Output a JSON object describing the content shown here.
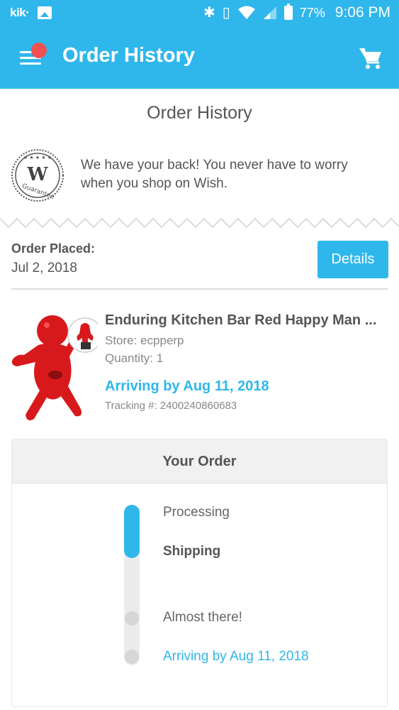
{
  "status_bar": {
    "app_label": "kik·",
    "battery_percent": "77%",
    "time": "9:06 PM",
    "icons": [
      "image-icon",
      "bluetooth-icon",
      "vibrate-icon",
      "wifi-icon",
      "signal-icon",
      "battery-icon"
    ]
  },
  "app_bar": {
    "title": "Order History",
    "menu_icon": "menu-icon",
    "cart_icon": "cart-icon"
  },
  "page": {
    "title": "Order History",
    "guarantee_badge_text": "Guarantee",
    "guarantee_badge_letter": "W",
    "guarantee_message": "We have your back! You never have to worry when you shop on Wish."
  },
  "order": {
    "placed_label": "Order Placed:",
    "placed_date": "Jul 2, 2018",
    "details_button": "Details"
  },
  "product": {
    "name": "Enduring Kitchen Bar Red Happy Man ...",
    "store": "Store: ecpperp",
    "quantity": "Quantity: 1",
    "arrival": "Arriving by Aug 11, 2018",
    "tracking": "Tracking #: 2400240860683"
  },
  "your_order": {
    "title": "Your Order",
    "progress_fraction": 0.33,
    "steps": [
      {
        "label": "Processing"
      },
      {
        "label": "Shipping"
      },
      {
        "label": "Almost there!"
      },
      {
        "label": "Arriving by Aug 11, 2018"
      }
    ]
  },
  "colors": {
    "brand_blue": "#2fb7ec",
    "notification_red": "#f05050",
    "product_red": "#d8191c"
  }
}
